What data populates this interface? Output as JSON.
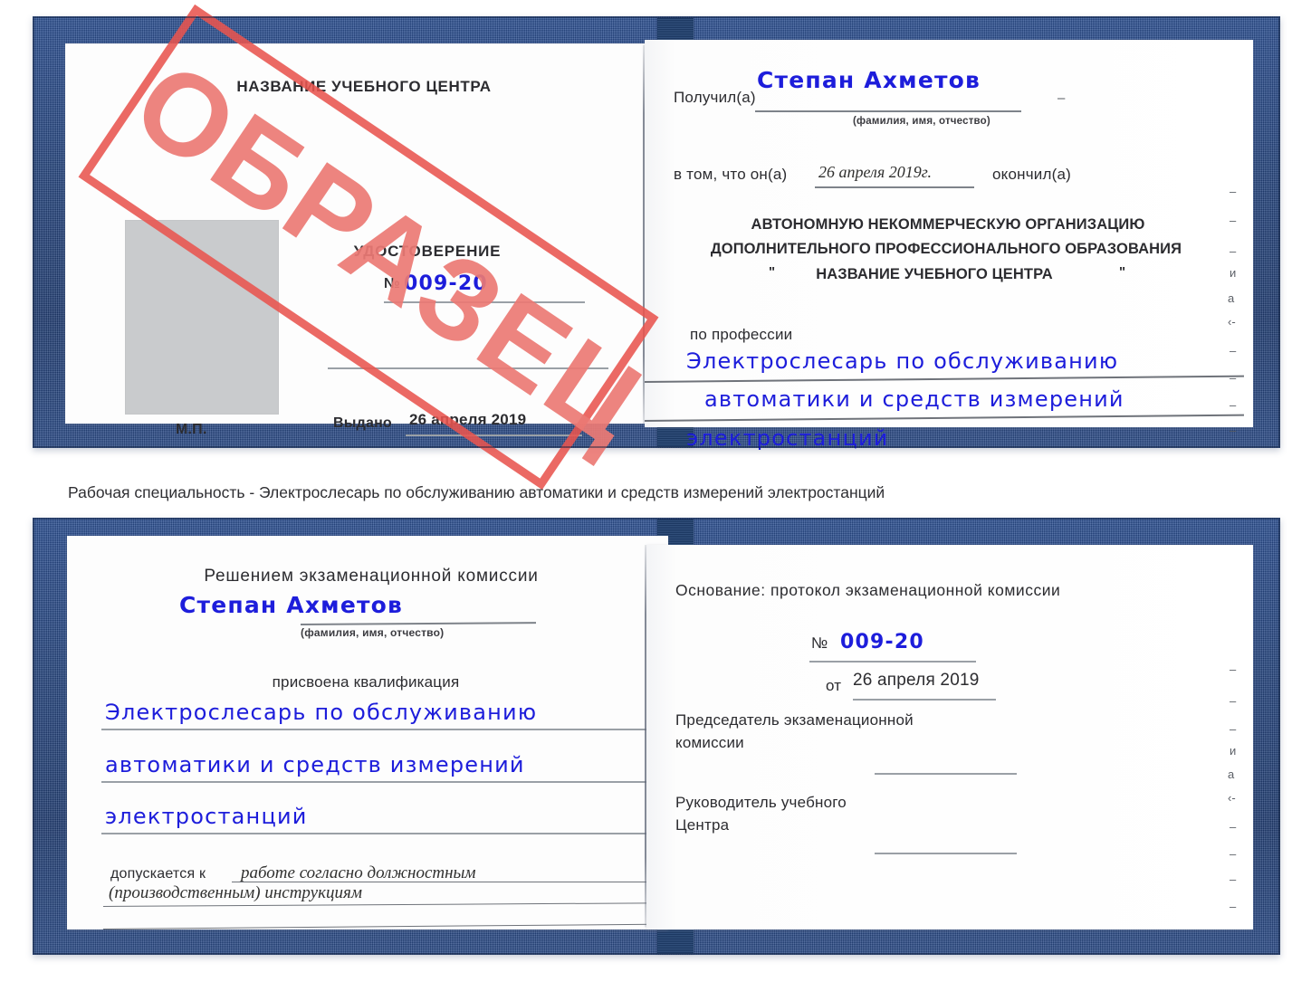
{
  "colors": {
    "cover_blue": "#25457f",
    "ink_blue": "#1d1ddb",
    "stamp_red": "#e8544f",
    "rule_gray": "#8e9299",
    "photo_gray": "#c9cbcd"
  },
  "watermark": {
    "text": "ОБРАЗЕЦ"
  },
  "certificate_top": {
    "left_page": {
      "center_name": "НАЗВАНИЕ УЧЕБНОГО ЦЕНТРА",
      "doc_type": "УДОСТОВЕРЕНИЕ",
      "number_label": "№",
      "number_value": "009-20",
      "issued_label": "Выдано",
      "issued_value": "26 апреля 2019",
      "seal_label": "М.П."
    },
    "right_page": {
      "received_label": "Получил(а)",
      "received_value": "Степан Ахметов",
      "fio_hint": "(фамилия, имя, отчество)",
      "that_he_label": "в том, что он(а)",
      "that_he_value": "26 апреля 2019г.",
      "finished_label": "окончил(а)",
      "org_line1": "АВТОНОМНУЮ НЕКОММЕРЧЕСКУЮ ОРГАНИЗАЦИЮ",
      "org_line2": "ДОПОЛНИТЕЛЬНОГО ПРОФЕССИОНАЛЬНОГО ОБРАЗОВАНИЯ",
      "org_quote_open": "\"",
      "org_line3": "НАЗВАНИЕ УЧЕБНОГО ЦЕНТРА",
      "org_quote_close": "\"",
      "profession_label": "по профессии",
      "profession_line1": "Электрослесарь по обслуживанию",
      "profession_line2": "автоматики и средств измерений",
      "profession_line3": "электростанций",
      "edge_marks": [
        "–",
        "–",
        "–",
        "и",
        "а",
        "‹-",
        "–",
        "–",
        "–",
        "–"
      ]
    }
  },
  "caption": {
    "text": "Рабочая специальность - Электрослесарь по обслуживанию автоматики и средств измерений электростанций"
  },
  "certificate_bottom": {
    "left_page": {
      "heading": "Решением экзаменационной комиссии",
      "name_value": "Степан Ахметов",
      "fio_hint": "(фамилия, имя, отчество)",
      "qualification_label": "присвоена квалификация",
      "qualification_line1": "Электрослесарь по обслуживанию",
      "qualification_line2": "автоматики и средств измерений",
      "qualification_line3": "электростанций",
      "admitted_label": "допускается к",
      "admitted_value_line1": "работе согласно должностным",
      "admitted_value_line2": "(производственным) инструкциям"
    },
    "right_page": {
      "basis_label": "Основание: протокол экзаменационной комиссии",
      "number_label": "№",
      "number_value": "009-20",
      "date_label": "от",
      "date_value": "26 апреля 2019",
      "chairman_line1": "Председатель экзаменационной",
      "chairman_line2": "комиссии",
      "head_line1": "Руководитель учебного",
      "head_line2": "Центра",
      "edge_marks": [
        "–",
        "–",
        "–",
        "и",
        "а",
        "‹-",
        "–",
        "–",
        "–",
        "–"
      ]
    }
  }
}
